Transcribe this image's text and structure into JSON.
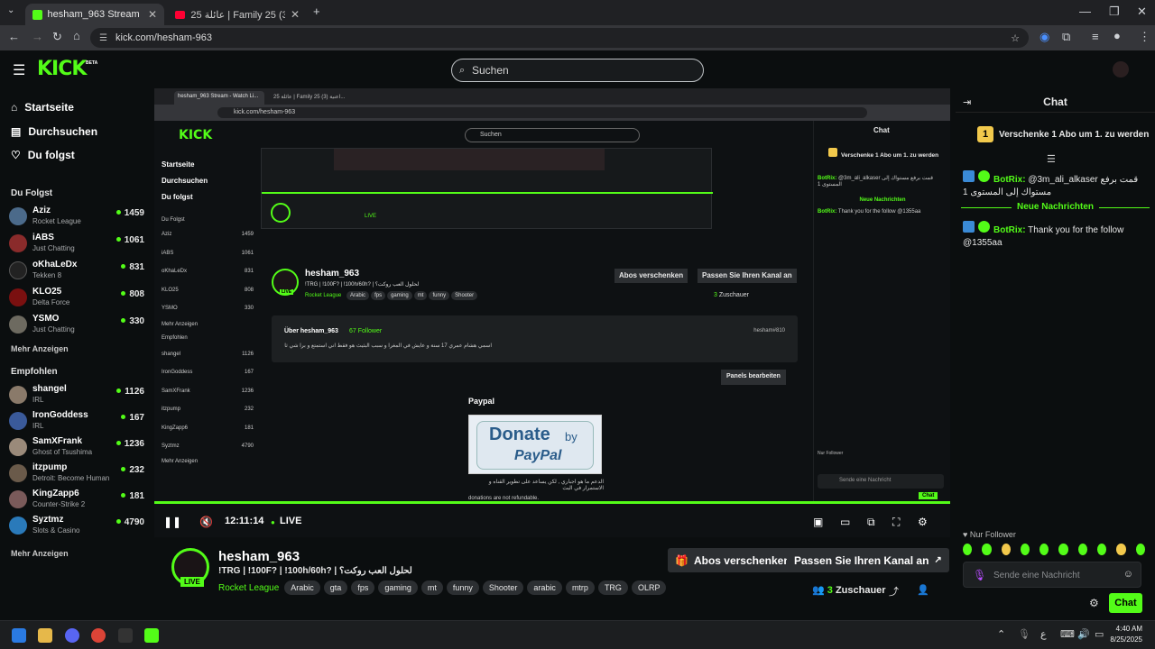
{
  "browser": {
    "tabs": [
      {
        "title": "hesham_963 Stream - Watch Li..."
      },
      {
        "title": "عائلة 25 | Family 25 (3) اعنية..."
      }
    ],
    "url": "kick.com/hesham-963"
  },
  "header": {
    "logo": "KICK",
    "logo_badge": "BETA",
    "search_placeholder": "Suchen"
  },
  "sidebar": {
    "nav": [
      {
        "label": "Startseite"
      },
      {
        "label": "Durchsuchen"
      },
      {
        "label": "Du folgst"
      }
    ],
    "following_title": "Du Folgst",
    "following": [
      {
        "name": "Aziz",
        "game": "Rocket League",
        "viewers": "1459"
      },
      {
        "name": "iABS",
        "game": "Just Chatting",
        "viewers": "1061"
      },
      {
        "name": "oKhaLeDx",
        "game": "Tekken 8",
        "viewers": "831"
      },
      {
        "name": "KLO25",
        "game": "Delta Force",
        "viewers": "808"
      },
      {
        "name": "YSMO",
        "game": "Just Chatting",
        "viewers": "330"
      }
    ],
    "more1": "Mehr Anzeigen",
    "recommended_title": "Empfohlen",
    "recommended": [
      {
        "name": "shangel",
        "game": "IRL",
        "viewers": "1126"
      },
      {
        "name": "IronGoddess",
        "game": "IRL",
        "viewers": "167"
      },
      {
        "name": "SamXFrank",
        "game": "Ghost of Tsushima",
        "viewers": "1236"
      },
      {
        "name": "itzpump",
        "game": "Detroit: Become Human",
        "viewers": "232"
      },
      {
        "name": "KingZapp6",
        "game": "Counter-Strike 2",
        "viewers": "181"
      },
      {
        "name": "Syztmz",
        "game": "Slots & Casino",
        "viewers": "4790"
      }
    ],
    "more2": "Mehr Anzeigen"
  },
  "inner": {
    "about_title": "Über hesham_963",
    "followers": "67 Follower",
    "handle": "hesham#810",
    "bio": "اسمي هشام عمري 17 سنة و عايش في المغرا و سبب البثيث هو فقط اني استمتع و برا شي ثاني",
    "panels_btn": "Panels bearbeiten",
    "paypal_title": "Paypal",
    "donate_line1": "Donate",
    "donate_by": "by",
    "donate_line2": "PayPal",
    "donate_caption1": "الدعم ما هو اجباري , لكن يساعد على تطوير القناه و الاستمرار في البث",
    "donate_caption2": "donations are not refundable.",
    "chat_title": "Chat",
    "gift_text": "Verschenke 1 Abo um 1. zu werden",
    "new_msgs": "Neue Nachrichten",
    "msg1_user": "BotRix:",
    "msg1_text": "@3m_ali_alkaser قمت برفع مستواك إلى المستوى 1",
    "msg2_user": "BotRix:",
    "msg2_text": "Thank you for the follow @1355aa",
    "send_placeholder": "Sende eine Nachricht",
    "chat_btn": "Chat",
    "follower_only": "Nur Follower"
  },
  "player": {
    "time": "12:11:14",
    "live": "LIVE"
  },
  "stream": {
    "channel": "hesham_963",
    "live_badge": "LIVE",
    "title": "!TRG | !100F? | !100h/60h? | لحلول العب روكت؟",
    "category": "Rocket League",
    "tags": [
      "Arabic",
      "gta",
      "fps",
      "gaming",
      "mt",
      "funny",
      "Shooter",
      "arabic",
      "mtrp",
      "TRG",
      "OLRP"
    ],
    "gift_btn": "Abos verschenken",
    "customize_btn": "Passen Sie Ihren Kanal an",
    "viewers_count": "3",
    "viewers_label": "Zuschauer"
  },
  "chat": {
    "title": "Chat",
    "gift_text": "Verschenke 1 Abo um 1. zu werden",
    "messages": [
      {
        "user": "BotRix:",
        "text": "@3m_ali_alkaser قمت برفع مستواك إلى المستوى 1"
      },
      {
        "user": "BotRix:",
        "text": "Thank you for the follow @1355aa"
      }
    ],
    "new_messages": "Neue Nachrichten",
    "follower_mode": "Nur Follower",
    "input_placeholder": "Sende eine Nachricht",
    "send_btn": "Chat"
  },
  "taskbar": {
    "time": "4:40 AM",
    "date": "8/25/2025",
    "lang": "ع"
  },
  "colors": {
    "accent": "#53fc18",
    "bg": "#0b0e0f"
  }
}
